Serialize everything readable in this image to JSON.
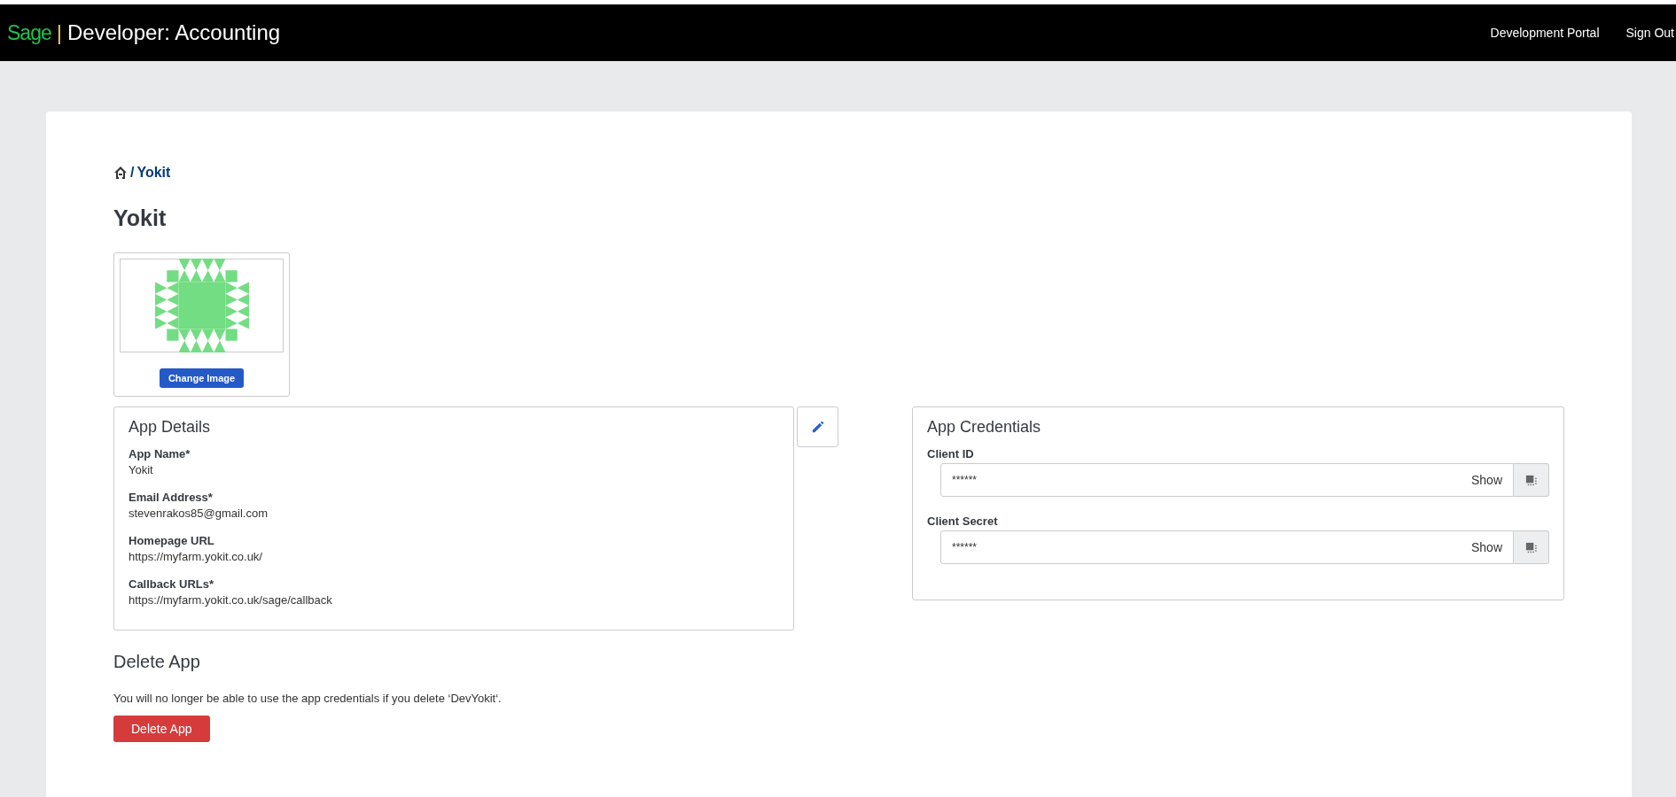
{
  "header": {
    "brand": "Sage",
    "separator": "|",
    "title": "Developer: Accounting",
    "links": [
      "Development Portal",
      "Sign Out"
    ]
  },
  "breadcrumb": {
    "separator": "/",
    "current": "Yokit"
  },
  "page_title": "Yokit",
  "image_card": {
    "button": "Change Image"
  },
  "app_details": {
    "title": "App Details",
    "fields": [
      {
        "label": "App Name*",
        "value": "Yokit"
      },
      {
        "label": "Email Address*",
        "value": "stevenrakos85@gmail.com"
      },
      {
        "label": "Homepage URL",
        "value": "https://myfarm.yokit.co.uk/"
      },
      {
        "label": "Callback URLs*",
        "value": "https://myfarm.yokit.co.uk/sage/callback"
      }
    ]
  },
  "app_credentials": {
    "title": "App Credentials",
    "fields": [
      {
        "label": "Client ID",
        "value": "******",
        "toggle": "Show"
      },
      {
        "label": "Client Secret",
        "value": "******",
        "toggle": "Show"
      }
    ]
  },
  "delete_section": {
    "title": "Delete App",
    "message": "You will no longer be able to use the app credentials if you delete ‘DevYokit‘.",
    "button": "Delete App"
  }
}
